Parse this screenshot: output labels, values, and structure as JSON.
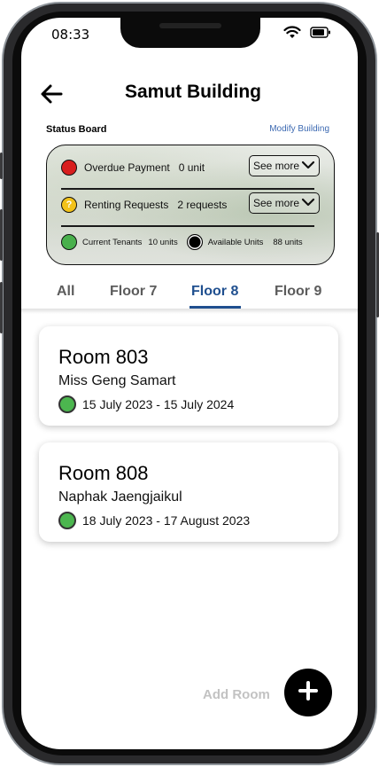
{
  "status_bar": {
    "time": "08:33"
  },
  "header": {
    "title": "Samut Building"
  },
  "status_board": {
    "label": "Status Board",
    "modify_label": "Modify Building",
    "overdue": {
      "label": "Overdue Payment",
      "value": "0 unit",
      "button": "See more"
    },
    "requests": {
      "label": "Renting Requests",
      "value": "2 requests",
      "button": "See more",
      "icon_glyph": "?"
    },
    "current": {
      "label": "Current Tenants",
      "value": "10 units"
    },
    "available": {
      "label": "Available Units",
      "value": "88 units"
    }
  },
  "tabs": [
    {
      "label": "All",
      "active": false
    },
    {
      "label": "Floor 7",
      "active": false
    },
    {
      "label": "Floor 8",
      "active": true
    },
    {
      "label": "Floor 9",
      "active": false
    }
  ],
  "rooms": [
    {
      "title": "Room 803",
      "tenant": "Miss Geng Samart",
      "period": "15 July 2023 - 15 July 2024",
      "status_color": "#4cb64f"
    },
    {
      "title": "Room 808",
      "tenant": "Naphak Jaengjaikul",
      "period": "18 July 2023 - 17 August 2023",
      "status_color": "#4cb64f"
    }
  ],
  "add_room": {
    "label": "Add Room"
  },
  "colors": {
    "accent": "#1f4f8f",
    "link": "#3d6ab2",
    "overdue": "#d81e1e",
    "requests": "#f2c21a",
    "current": "#49b04c"
  },
  "icons": [
    "back-arrow-icon",
    "signal-icon",
    "wifi-icon",
    "battery-icon",
    "chevron-down-icon",
    "question-icon",
    "plus-icon"
  ]
}
